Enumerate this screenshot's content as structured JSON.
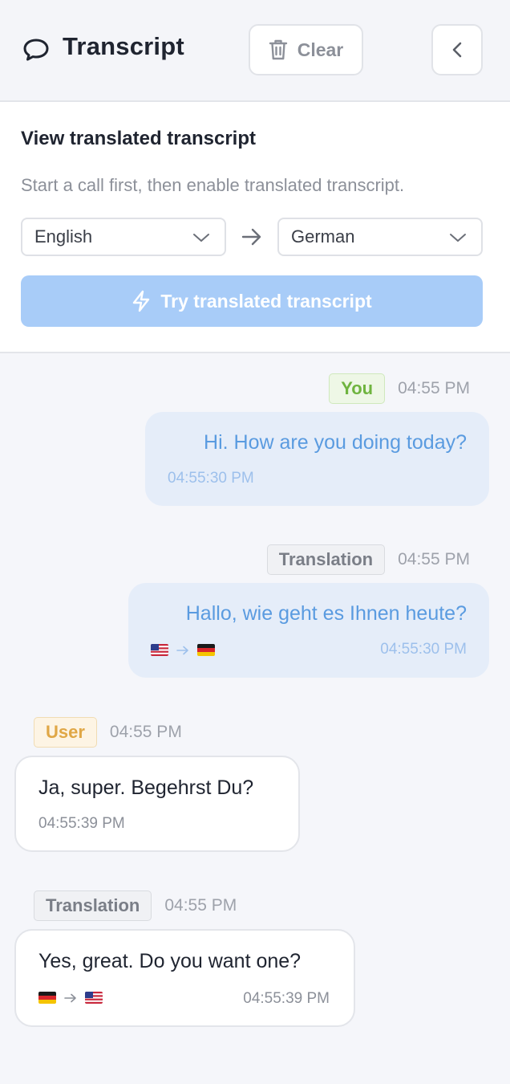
{
  "header": {
    "title": "Transcript",
    "clear_label": "Clear"
  },
  "translate": {
    "heading": "View translated transcript",
    "hint": "Start a call first, then enable translated transcript.",
    "from_language": "English",
    "to_language": "German",
    "try_label": "Try translated transcript"
  },
  "messages": [
    {
      "badge": "You",
      "time": "04:55 PM",
      "text": "Hi. How are you doing today?",
      "stamp": "04:55:30 PM"
    },
    {
      "badge": "Translation",
      "time": "04:55 PM",
      "text": "Hallo, wie geht es Ihnen heute?",
      "stamp": "04:55:30 PM",
      "from_flag": "us-flag",
      "to_flag": "de-flag"
    },
    {
      "badge": "User",
      "time": "04:55 PM",
      "text": "Ja, super. Begehrst Du?",
      "stamp": "04:55:39 PM"
    },
    {
      "badge": "Translation",
      "time": "04:55 PM",
      "text": "Yes, great. Do you want one?",
      "stamp": "04:55:39 PM",
      "from_flag": "de-flag",
      "to_flag": "us-flag"
    }
  ],
  "colors": {
    "accent": "#5a9be0",
    "try_button": "#a8ccf8",
    "you_badge": "#6fb43f",
    "user_badge": "#e0a746"
  }
}
